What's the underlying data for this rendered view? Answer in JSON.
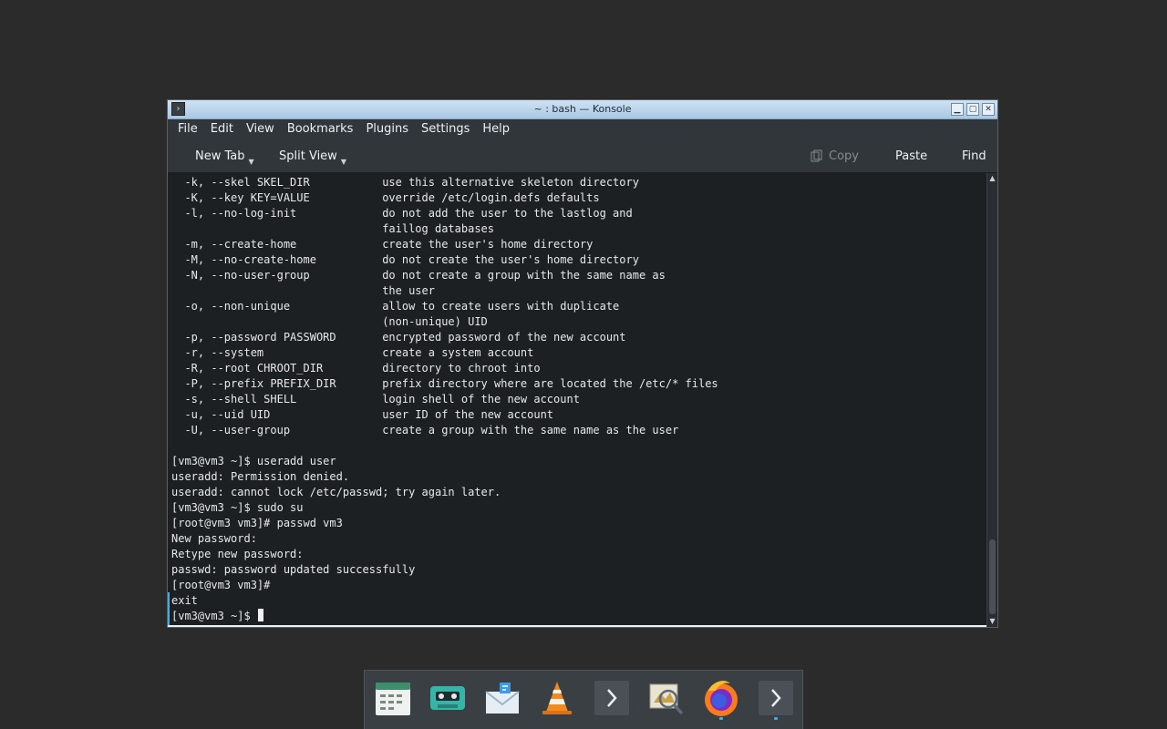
{
  "window": {
    "title": "~ : bash — Konsole",
    "buttons": {
      "minimize": "▁",
      "maximize": "▢",
      "close": "✕"
    }
  },
  "menubar": [
    "File",
    "Edit",
    "View",
    "Bookmarks",
    "Plugins",
    "Settings",
    "Help"
  ],
  "toolbar": {
    "new_tab": "New Tab",
    "split_view": "Split View",
    "copy": "Copy",
    "paste": "Paste",
    "find": "Find"
  },
  "terminal": {
    "lines": [
      "  -k, --skel SKEL_DIR           use this alternative skeleton directory",
      "  -K, --key KEY=VALUE           override /etc/login.defs defaults",
      "  -l, --no-log-init             do not add the user to the lastlog and",
      "                                faillog databases",
      "  -m, --create-home             create the user's home directory",
      "  -M, --no-create-home          do not create the user's home directory",
      "  -N, --no-user-group           do not create a group with the same name as",
      "                                the user",
      "  -o, --non-unique              allow to create users with duplicate",
      "                                (non-unique) UID",
      "  -p, --password PASSWORD       encrypted password of the new account",
      "  -r, --system                  create a system account",
      "  -R, --root CHROOT_DIR         directory to chroot into",
      "  -P, --prefix PREFIX_DIR       prefix directory where are located the /etc/* files",
      "  -s, --shell SHELL             login shell of the new account",
      "  -u, --uid UID                 user ID of the new account",
      "  -U, --user-group              create a group with the same name as the user",
      "",
      "[vm3@vm3 ~]$ useradd user",
      "useradd: Permission denied.",
      "useradd: cannot lock /etc/passwd; try again later.",
      "[vm3@vm3 ~]$ sudo su",
      "[root@vm3 vm3]# passwd vm3",
      "New password:",
      "Retype new password:",
      "passwd: password updated successfully",
      "[root@vm3 vm3]#",
      "exit"
    ],
    "prompt": "[vm3@vm3 ~]$ "
  },
  "dock": {
    "items": [
      "calendar-icon",
      "cassette-player-icon",
      "mail-icon",
      "vlc-cone-icon",
      "terminal-icon",
      "image-viewer-icon",
      "firefox-icon",
      "terminal-icon-2"
    ]
  },
  "colors": {
    "accent": "#3daee9",
    "terminal_bg": "#1d2023",
    "menubar_bg": "#31363b"
  }
}
